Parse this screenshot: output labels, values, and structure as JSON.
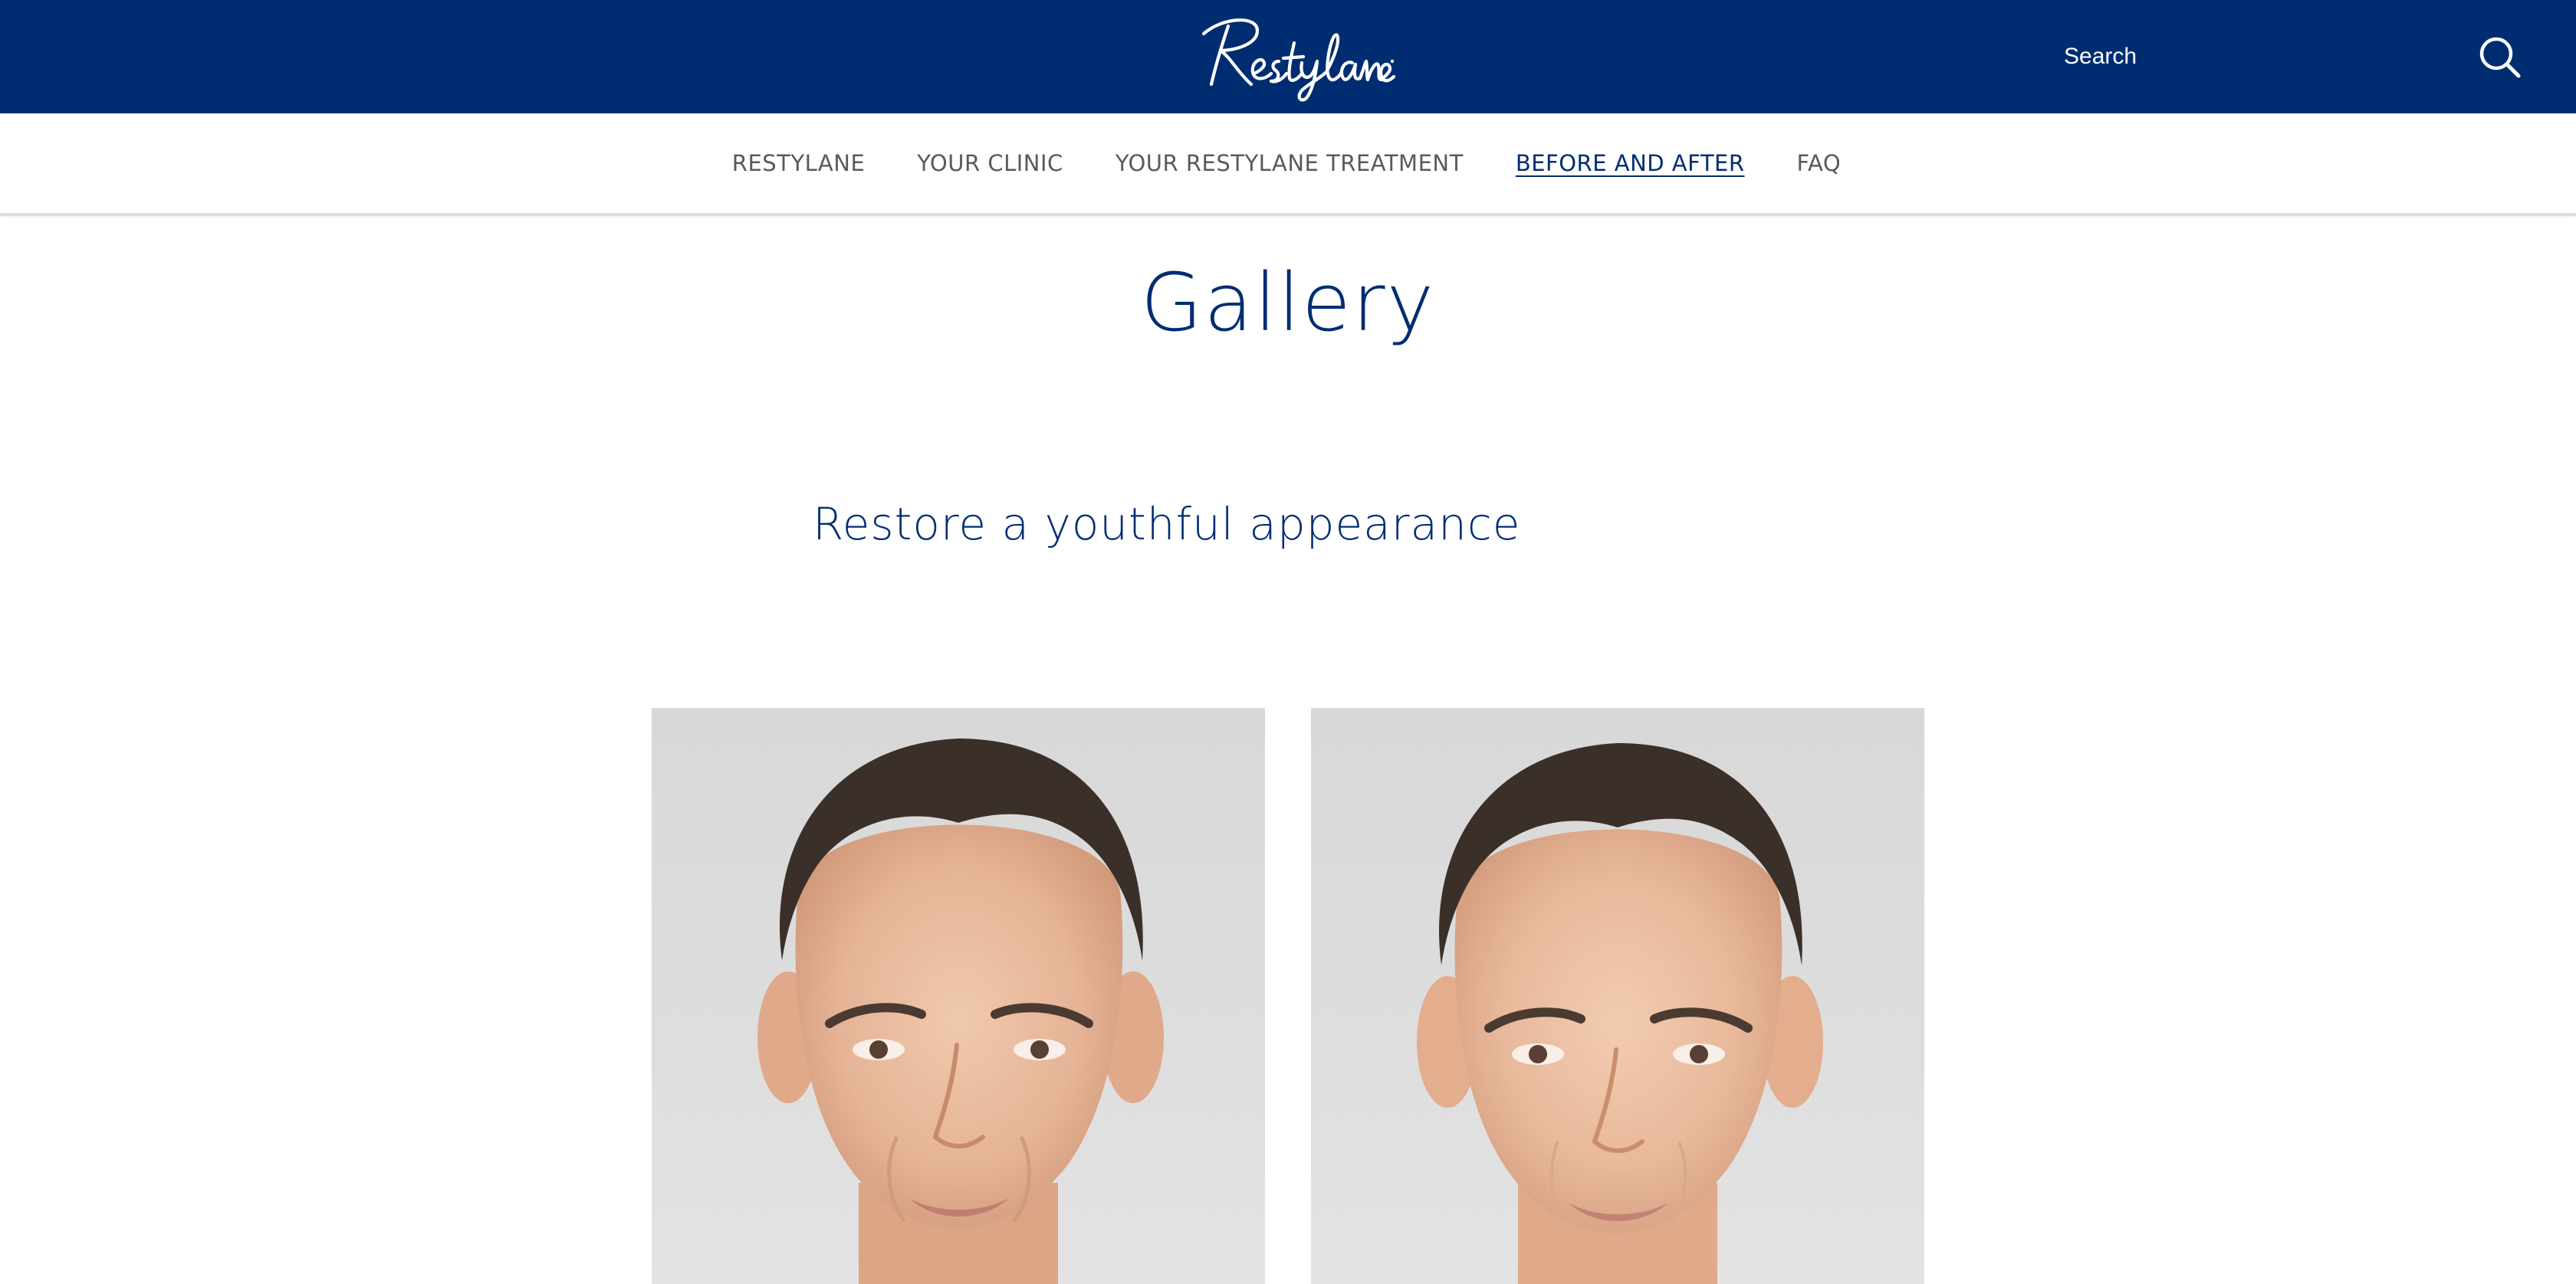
{
  "header": {
    "logo_text": "Restylane",
    "search_label": "Search",
    "search_icon": "search-icon",
    "background_color": "#002d72"
  },
  "nav": {
    "items": [
      {
        "label": "RESTYLANE",
        "active": false
      },
      {
        "label": "YOUR CLINIC",
        "active": false
      },
      {
        "label": "YOUR RESTYLANE TREATMENT",
        "active": false
      },
      {
        "label": "BEFORE AND AFTER",
        "active": true
      },
      {
        "label": "FAQ",
        "active": false
      }
    ]
  },
  "main": {
    "page_title": "Gallery",
    "section_heading": "Restore a youthful appearance",
    "gallery": [
      {
        "image": "man-face-portrait-before",
        "alt": ""
      },
      {
        "image": "man-face-portrait-after",
        "alt": ""
      }
    ]
  },
  "colors": {
    "brand_navy": "#002d72",
    "nav_text": "#5a5a5a",
    "photo_background": "#dadada"
  }
}
